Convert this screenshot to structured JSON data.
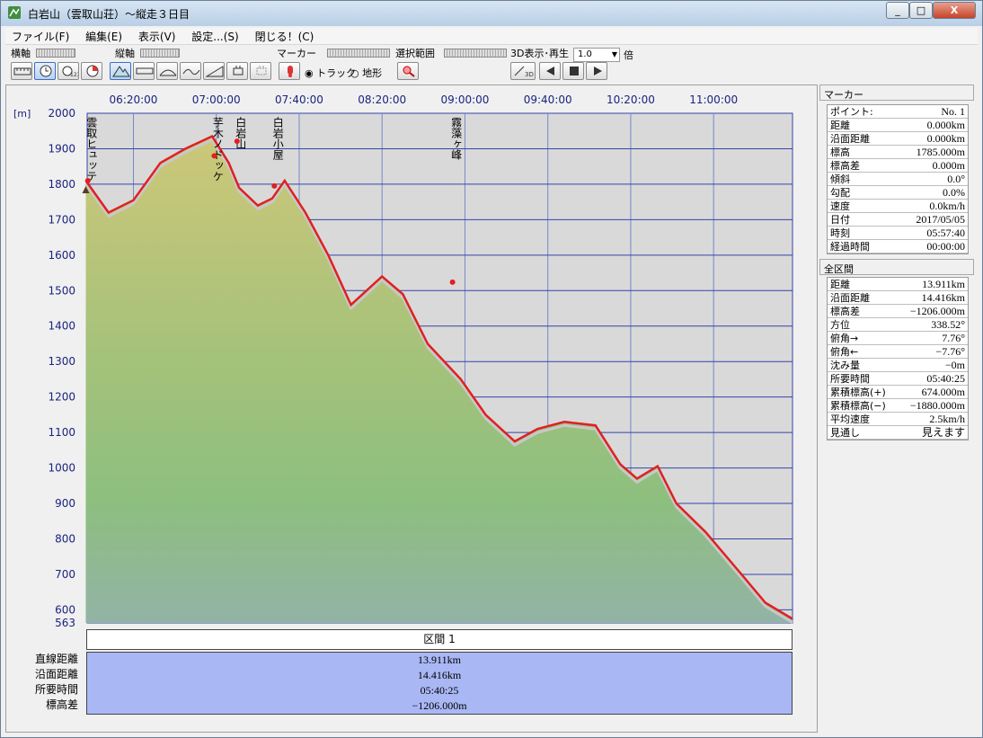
{
  "window": {
    "title": "白岩山（雲取山荘）～縦走３日目"
  },
  "menu": [
    "ファイル(F)",
    "編集(E)",
    "表示(V)",
    "設定...(S)",
    "閉じる！(C)"
  ],
  "toolbar": {
    "horizontal_axis": "横軸",
    "vertical_axis": "縦軸",
    "marker": "マーカー",
    "marker_track": "トラック",
    "marker_terrain": "地形",
    "select_range": "選択範囲",
    "playback_3d": "3D表示･再生",
    "speed_value": "1.0",
    "speed_unit": "倍"
  },
  "chart_data": {
    "type": "area",
    "ylabel": "[m]",
    "ylim": [
      563,
      2000
    ],
    "y_ticks": [
      "2000",
      "1900",
      "1800",
      "1700",
      "1600",
      "1500",
      "1400",
      "1300",
      "1200",
      "1100",
      "1000",
      "900",
      "800",
      "700",
      "600",
      "563"
    ],
    "x_ticks": [
      "06:20:00",
      "07:00:00",
      "07:40:00",
      "08:20:00",
      "09:00:00",
      "09:40:00",
      "10:20:00",
      "11:00:00"
    ],
    "x_start": "05:57:40",
    "x_end": "11:38:05",
    "series": [
      {
        "color_track": "#e02020",
        "color_terrain": "#c8c8c8",
        "x": [
          "05:57",
          "06:08",
          "06:20",
          "06:33",
          "06:45",
          "06:58",
          "07:06",
          "07:11",
          "07:20",
          "07:27",
          "07:33",
          "07:43",
          "07:54",
          "08:05",
          "08:20",
          "08:30",
          "08:42",
          "08:58",
          "09:10",
          "09:24",
          "09:35",
          "09:48",
          "10:03",
          "10:15",
          "10:23",
          "10:33",
          "10:42",
          "10:56",
          "11:12",
          "11:25",
          "11:38"
        ],
        "elevation": [
          1810,
          1720,
          1755,
          1860,
          1900,
          1935,
          1860,
          1790,
          1740,
          1760,
          1810,
          1720,
          1600,
          1460,
          1540,
          1490,
          1350,
          1250,
          1150,
          1075,
          1110,
          1130,
          1120,
          1010,
          970,
          1005,
          900,
          820,
          710,
          620,
          575
        ]
      }
    ],
    "waypoints": [
      {
        "label": "雲取ヒュッテ",
        "x": "05:58",
        "elevation": 1810
      },
      {
        "label": "芋木ノドッケ",
        "x": "06:59",
        "elevation": 1880
      },
      {
        "label": "白岩山",
        "x": "07:10",
        "elevation": 1921
      },
      {
        "label": "白岩小屋",
        "x": "07:28",
        "elevation": 1795
      },
      {
        "label": "霧藻ヶ峰",
        "x": "08:54",
        "elevation": 1524
      }
    ]
  },
  "marker_panel": {
    "title": "マーカー",
    "rows": [
      {
        "label": "ポイント:",
        "value": "No. 1"
      },
      {
        "label": "距離",
        "value": "0.000km"
      },
      {
        "label": "沿面距離",
        "value": "0.000km"
      },
      {
        "label": "標高",
        "value": "1785.000m"
      },
      {
        "label": "標高差",
        "value": "0.000m"
      },
      {
        "label": "傾斜",
        "value": "0.0°"
      },
      {
        "label": "勾配",
        "value": "0.0%"
      },
      {
        "label": "速度",
        "value": "0.0km/h"
      },
      {
        "label": "日付",
        "value": "2017/05/05"
      },
      {
        "label": "時刻",
        "value": "05:57:40"
      },
      {
        "label": "経過時間",
        "value": "00:00:00"
      }
    ]
  },
  "total_panel": {
    "title": "全区間",
    "rows": [
      {
        "label": "距離",
        "value": "13.911km"
      },
      {
        "label": "沿面距離",
        "value": "14.416km"
      },
      {
        "label": "標高差",
        "value": "−1206.000m"
      },
      {
        "label": "方位",
        "value": "338.52°"
      },
      {
        "label": "俯角→",
        "value": "7.76°"
      },
      {
        "label": "俯角←",
        "value": "−7.76°"
      },
      {
        "label": "沈み量",
        "value": "−0m"
      },
      {
        "label": "所要時間",
        "value": "05:40:25"
      },
      {
        "label": "累積標高(+)",
        "value": "674.000m"
      },
      {
        "label": "累積標高(−)",
        "value": "−1880.000m"
      },
      {
        "label": "平均速度",
        "value": "2.5km/h"
      },
      {
        "label": "見通し",
        "value": "見えます"
      }
    ]
  },
  "summary": {
    "section": "区間 1",
    "labels": [
      "直線距離",
      "沿面距離",
      "所要時間",
      "標高差"
    ],
    "values": [
      "13.911km",
      "14.416km",
      "05:40:25",
      "−1206.000m"
    ]
  }
}
